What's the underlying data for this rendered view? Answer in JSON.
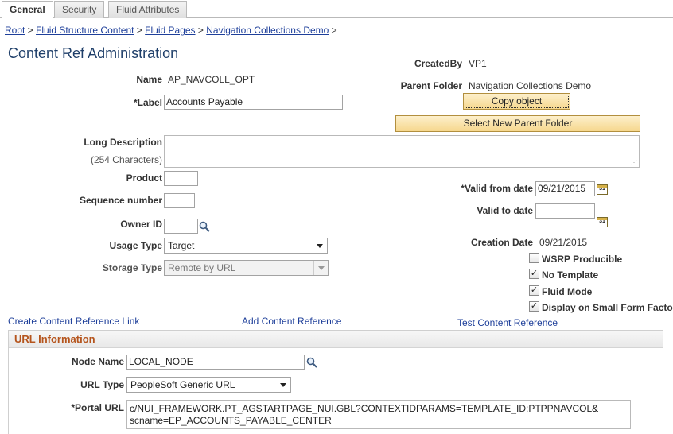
{
  "tabs": [
    {
      "label": "General",
      "active": true
    },
    {
      "label": "Security",
      "active": false
    },
    {
      "label": "Fluid Attributes",
      "active": false
    }
  ],
  "breadcrumb": {
    "items": [
      "Root",
      "Fluid Structure Content",
      "Fluid Pages",
      "Navigation Collections Demo"
    ],
    "separator": ">"
  },
  "page_title": "Content Ref Administration",
  "form": {
    "name_label": "Name",
    "name_value": "AP_NAVCOLL_OPT",
    "label_label": "*Label",
    "label_value": "Accounts Payable",
    "long_desc_label": "Long Description",
    "long_desc_hint": "(254 Characters)",
    "long_desc_value": "",
    "product_label": "Product",
    "sequence_label": "Sequence number",
    "owner_label": "Owner ID",
    "usage_label": "Usage Type",
    "usage_value": "Target",
    "storage_label": "Storage Type",
    "storage_value": "Remote by URL"
  },
  "right": {
    "created_by_label": "CreatedBy",
    "created_by_value": "VP1",
    "parent_folder_label": "Parent Folder",
    "parent_folder_value": "Navigation Collections Demo",
    "copy_button": "Copy object",
    "select_parent_button": "Select New Parent Folder",
    "valid_from_label": "*Valid from date",
    "valid_from_value": "09/21/2015",
    "valid_to_label": "Valid to date",
    "valid_to_value": "",
    "creation_date_label": "Creation Date",
    "creation_date_value": "09/21/2015",
    "calendar_icon_text": "31",
    "checkboxes": [
      {
        "label": "WSRP Producible",
        "checked": false
      },
      {
        "label": "No Template",
        "checked": true
      },
      {
        "label": "Fluid Mode",
        "checked": true
      },
      {
        "label": "Display on Small Form Factor",
        "checked": true
      }
    ]
  },
  "links": {
    "create": "Create Content Reference Link",
    "add": "Add Content Reference",
    "test": "Test Content Reference"
  },
  "url_info": {
    "header": "URL Information",
    "node_label": "Node Name",
    "node_value": "LOCAL_NODE",
    "url_type_label": "URL Type",
    "url_type_value": "PeopleSoft Generic URL",
    "portal_url_label": "*Portal URL",
    "portal_url_line1": "c/NUI_FRAMEWORK.PT_AGSTARTPAGE_NUI.GBL?CONTEXTIDPARAMS=TEMPLATE_ID:PTPPNAVCOL&",
    "portal_url_line2": "scname=EP_ACCOUNTS_PAYABLE_CENTER"
  },
  "colors": {
    "link": "#1e3f9a",
    "title": "#1f3f6a",
    "section_header": "#b5541c",
    "button_fill": "#f6d78d"
  },
  "icons": [
    "magnifier-icon",
    "calendar-icon",
    "chevron-down-icon",
    "checkmark-icon",
    "resize-grip-icon"
  ]
}
